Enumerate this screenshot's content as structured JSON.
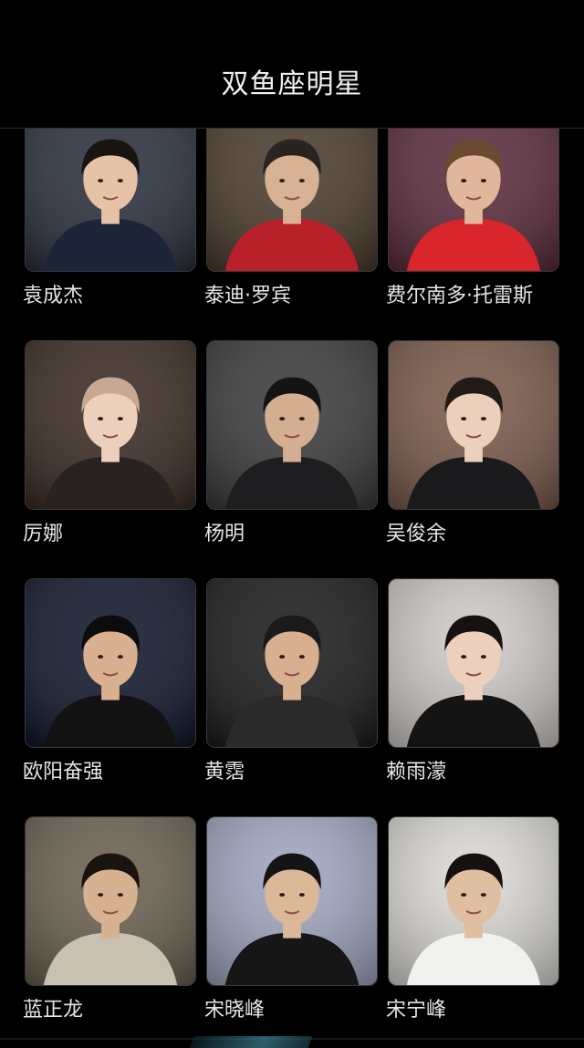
{
  "header": {
    "title": "双鱼座明星"
  },
  "celebrities": [
    {
      "name": "袁成杰",
      "bg": "#2a2f3c",
      "skin": "#e6c2a6",
      "outfit": "#1c2538",
      "hair": "#1a1410"
    },
    {
      "name": "泰迪·罗宾",
      "bg": "#4a3a2c",
      "skin": "#d8b294",
      "outfit": "#b8202a",
      "hair": "#2a2420"
    },
    {
      "name": "费尔南多·托雷斯",
      "bg": "#5a2a3a",
      "skin": "#e0b79a",
      "outfit": "#d8262c",
      "hair": "#6a4a30"
    },
    {
      "name": "厉娜",
      "bg": "#3a2a22",
      "skin": "#ecd0bc",
      "outfit": "#2a2220",
      "hair": "#c8a890"
    },
    {
      "name": "杨明",
      "bg": "#3a3a3c",
      "skin": "#d4ae90",
      "outfit": "#1e1e20",
      "hair": "#141414"
    },
    {
      "name": "吴俊余",
      "bg": "#7a5a4a",
      "skin": "#ecd0bc",
      "outfit": "#1a1a1c",
      "hair": "#221a16"
    },
    {
      "name": "欧阳奋强",
      "bg": "#10162a",
      "skin": "#d9b090",
      "outfit": "#121212",
      "hair": "#0c0c0c"
    },
    {
      "name": "黄霑",
      "bg": "#1a1a1c",
      "skin": "#d8b090",
      "outfit": "#2a2a2a",
      "hair": "#1a1a1a"
    },
    {
      "name": "赖雨濛",
      "bg": "#cfcac6",
      "skin": "#ecd0bc",
      "outfit": "#141414",
      "hair": "#161210"
    },
    {
      "name": "蓝正龙",
      "bg": "#6a6050",
      "skin": "#d6b290",
      "outfit": "#c8c0b0",
      "hair": "#1a140e"
    },
    {
      "name": "宋晓峰",
      "bg": "#a0a6c0",
      "skin": "#dab898",
      "outfit": "#161616",
      "hair": "#141414"
    },
    {
      "name": "宋宁峰",
      "bg": "#dcdad6",
      "skin": "#e0bea0",
      "outfit": "#f0f0ee",
      "hair": "#14110f"
    }
  ]
}
